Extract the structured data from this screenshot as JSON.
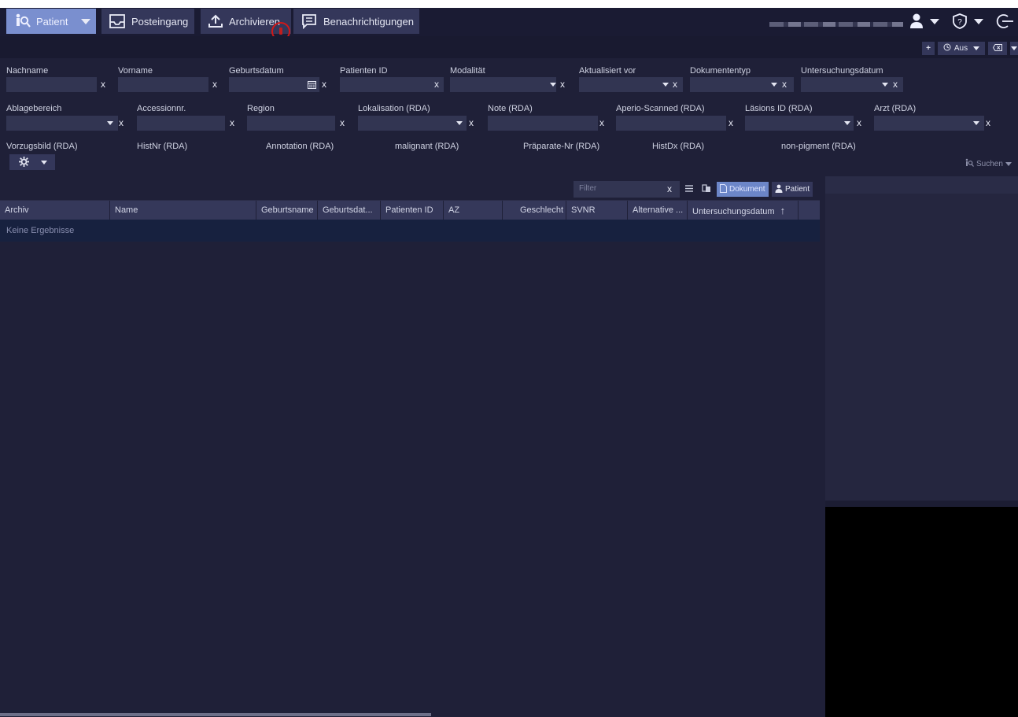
{
  "colors": {
    "accent": "#7a8fcf",
    "background": "#1f2038",
    "bar": "#1a1b33",
    "button": "#34375a",
    "highlight": "#d21818"
  },
  "topbar": {
    "patient_label": "Patient",
    "inbox_label": "Posteingang",
    "archive_label": "Archivieren",
    "notifications_label": "Benachrichtigungen"
  },
  "toolbar2": {
    "add_label": "+",
    "aus_label": "Aus"
  },
  "filters": {
    "row1": [
      "Nachname",
      "Vorname",
      "Geburtsdatum",
      "Patienten ID",
      "Modalität",
      "Aktualisiert vor",
      "Dokumententyp",
      "Untersuchungsdatum"
    ],
    "row2": [
      "Ablagebereich",
      "Accessionnr.",
      "Region",
      "Lokalisation (RDA)",
      "Note (RDA)",
      "Aperio-Scanned (RDA)",
      "Läsions ID (RDA)",
      "Arzt (RDA)"
    ],
    "row3": [
      "Vorzugsbild (RDA)",
      "HistNr (RDA)",
      "Annotation (RDA)",
      "malignant (RDA)",
      "Präparate-Nr (RDA)",
      "HistDx (RDA)",
      "non-pigment (RDA)"
    ],
    "clear_label": "x",
    "search_label": "Suchen"
  },
  "table": {
    "filter_placeholder": "Filter",
    "document_label": "Dokument",
    "patient_label": "Patient",
    "columns": [
      "Archiv",
      "Name",
      "Geburtsname",
      "Geburtsdat...",
      "Patienten ID",
      "AZ",
      "Geschlecht",
      "SVNR",
      "Alternative ...",
      "Untersuchungsdatum"
    ],
    "sort_indicator": "↑",
    "empty_text": "Keine Ergebnisse"
  }
}
